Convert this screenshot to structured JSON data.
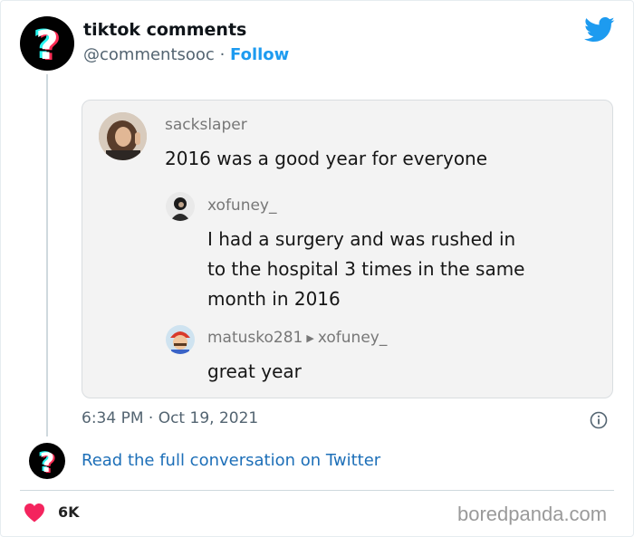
{
  "tweet": {
    "author_name": "tiktok comments",
    "author_handle": "@commentsooc",
    "separator": "·",
    "follow_label": "Follow",
    "timestamp": "6:34 PM · Oct 19, 2021",
    "read_more": "Read the full conversation on Twitter",
    "likes": "6K"
  },
  "embed": {
    "comments": [
      {
        "user": "sackslaper",
        "text": "2016 was a good year for everyone"
      },
      {
        "user": "xofuney_",
        "lines": [
          "I had a surgery and was rushed in",
          "to the hospital 3 times in the same",
          "month in 2016"
        ]
      },
      {
        "user": "matusko281",
        "reply_to": "xofuney_",
        "text": "great year"
      }
    ]
  },
  "watermark": "boredpanda.com",
  "colors": {
    "twitter_blue": "#1d9bf0",
    "heart_red": "#f4245e",
    "tiktok_cyan": "#25f4ee",
    "tiktok_pink": "#fe2c55"
  },
  "icons": [
    "tiktok-question-logo-icon",
    "twitter-bird-icon",
    "info-icon",
    "heart-icon"
  ]
}
